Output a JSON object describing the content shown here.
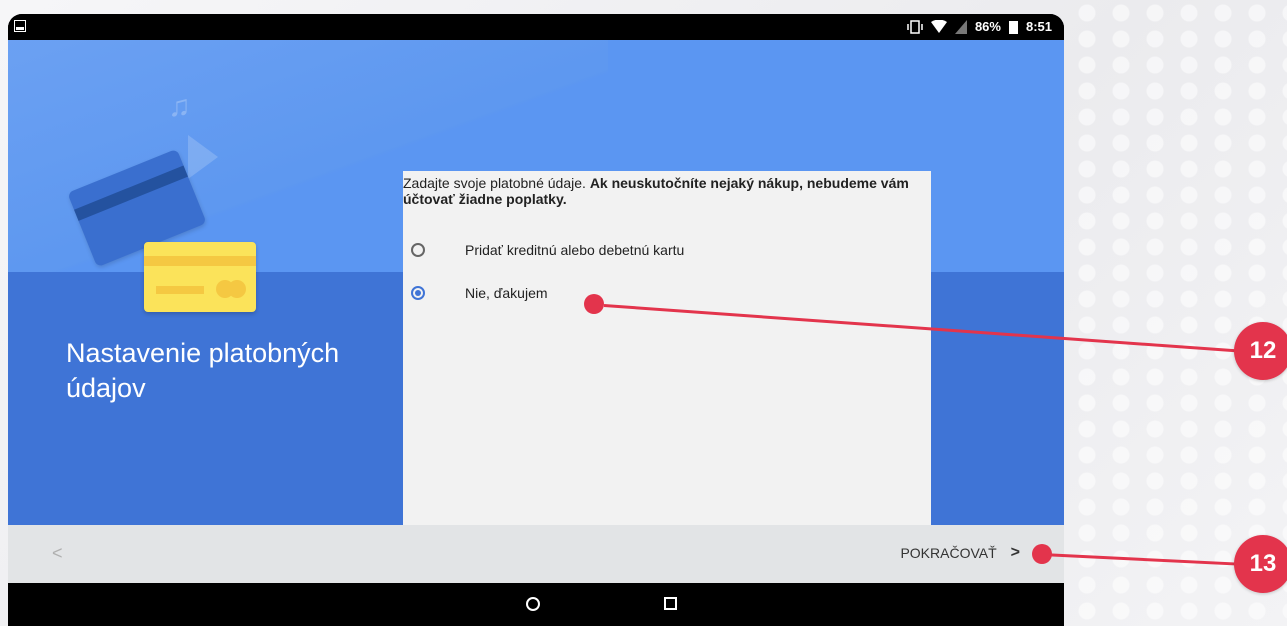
{
  "status_bar": {
    "battery": "86%",
    "time": "8:51"
  },
  "screen": {
    "title": "Nastavenie platobných údajov",
    "intro_normal": "Zadajte svoje platobné údaje. ",
    "intro_bold": "Ak neuskutočníte nejaký nákup, nebudeme vám účtovať žiadne poplatky.",
    "options": [
      {
        "label": "Pridať kreditnú alebo debetnú kartu",
        "checked": false
      },
      {
        "label": "Nie, ďakujem",
        "checked": true
      }
    ]
  },
  "footer": {
    "back_glyph": "<",
    "next_label": "POKRAČOVAŤ",
    "next_glyph": ">"
  },
  "callouts": [
    "12",
    "13"
  ],
  "colors": {
    "accent": "#3f74d6",
    "callout": "#e3344c"
  }
}
